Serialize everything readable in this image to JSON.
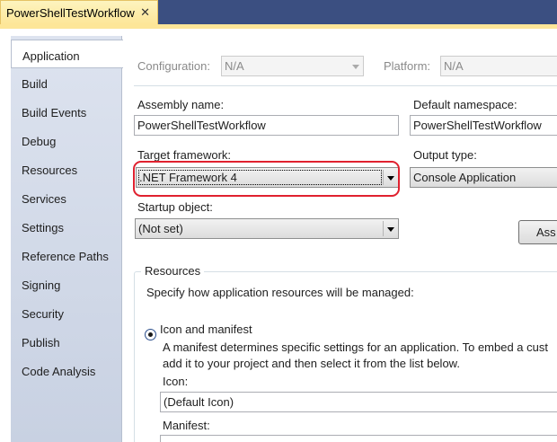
{
  "document_tab": {
    "title": "PowerShellTestWorkflow",
    "close_glyph": "✕"
  },
  "sidebar": {
    "items": [
      {
        "label": "Application",
        "active": true
      },
      {
        "label": "Build"
      },
      {
        "label": "Build Events"
      },
      {
        "label": "Debug"
      },
      {
        "label": "Resources"
      },
      {
        "label": "Services"
      },
      {
        "label": "Settings"
      },
      {
        "label": "Reference Paths"
      },
      {
        "label": "Signing"
      },
      {
        "label": "Security"
      },
      {
        "label": "Publish"
      },
      {
        "label": "Code Analysis"
      }
    ]
  },
  "config": {
    "configuration_label": "Configuration:",
    "configuration_value": "N/A",
    "platform_label": "Platform:",
    "platform_value": "N/A"
  },
  "form": {
    "assembly_name_label": "Assembly name:",
    "assembly_name_value": "PowerShellTestWorkflow",
    "default_namespace_label": "Default namespace:",
    "default_namespace_value": "PowerShellTestWorkflow",
    "target_framework_label": "Target framework:",
    "target_framework_value": ".NET Framework 4",
    "output_type_label": "Output type:",
    "output_type_value": "Console Application",
    "startup_object_label": "Startup object:",
    "startup_object_value": "(Not set)",
    "assembly_info_button": "Ass"
  },
  "resources": {
    "group_title": "Resources",
    "description": "Specify how application resources will be managed:",
    "icon_manifest_option": "Icon and manifest",
    "manifest_help_line1": "A manifest determines specific settings for an application. To embed a cust",
    "manifest_help_line2": "add it to your project and then select it from the list below.",
    "icon_label": "Icon:",
    "icon_value": "(Default Icon)",
    "manifest_label": "Manifest:"
  },
  "colors": {
    "tabstrip": "#3b4f81",
    "active_tab": "#fde698",
    "highlight_ring": "#e0212f"
  }
}
